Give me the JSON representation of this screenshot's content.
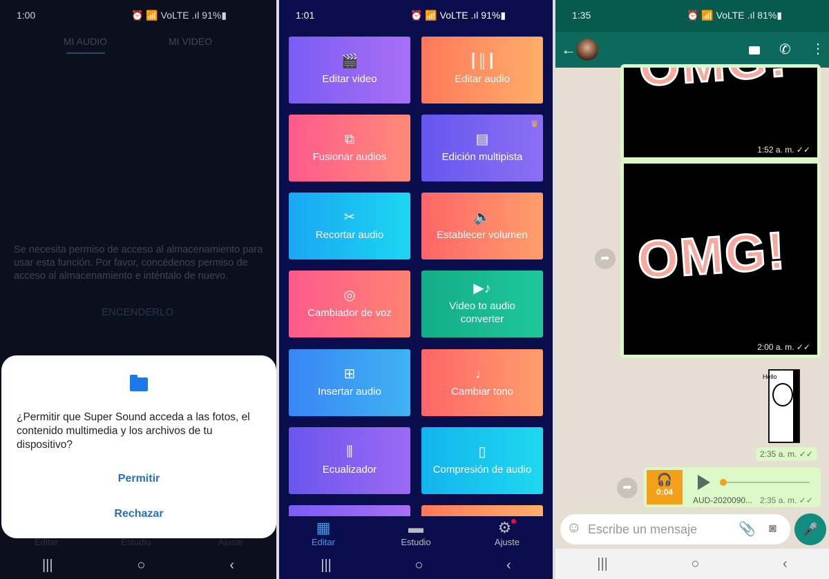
{
  "panel1": {
    "status": {
      "time": "1:00",
      "icons": "⏰ 📶 VoLTE .ıl 91%▮"
    },
    "tabs": [
      "MI AUDIO",
      "MI VIDEO"
    ],
    "message": "Se necesita permiso de acceso al almacenamiento para usar esta función. Por favor, concédenos permiso de acceso al almacenamiento e inténtalo de nuevo.",
    "turn_on": "ENCENDERLO",
    "dialog": {
      "icon": "folder-icon",
      "question": "¿Permitir que Super Sound acceda a las fotos, el contenido multimedia y los archivos de tu dispositivo?",
      "allow": "Permitir",
      "deny": "Rechazar"
    },
    "nav": [
      "Editar",
      "Estudio",
      "Ajuste"
    ]
  },
  "panel2": {
    "status": {
      "time": "1:01",
      "icons": "⏰ 📶 VoLTE .ıl 91%▮"
    },
    "tiles": [
      {
        "label": "Editar video",
        "icon": "🎬",
        "from": "#7a5cf6",
        "to": "#a86ff3"
      },
      {
        "label": "Editar audio",
        "icon": "┃║┃",
        "from": "#ff785a",
        "to": "#ffae68"
      },
      {
        "label": "Fusionar audios",
        "icon": "⧉",
        "from": "#ff5a8c",
        "to": "#ff8a78"
      },
      {
        "label": "Edición multipista",
        "icon": "▤",
        "from": "#6557ee",
        "to": "#8b6ff4",
        "crown": "♛"
      },
      {
        "label": "Recortar audio",
        "icon": "✂",
        "from": "#1aa6f4",
        "to": "#1cd6f2"
      },
      {
        "label": "Establecer volumen",
        "icon": "🔈",
        "from": "#ff6568",
        "to": "#ff9e6a"
      },
      {
        "label": "Cambiador de voz",
        "icon": "◎",
        "from": "#ff5a8c",
        "to": "#ff8272"
      },
      {
        "label": "Video to audio converter",
        "icon": "▶♪",
        "from": "#14ad86",
        "to": "#1fc79b"
      },
      {
        "label": "Insertar audio",
        "icon": "⊞",
        "from": "#3886f4",
        "to": "#3fb2f3"
      },
      {
        "label": "Cambiar tono",
        "icon": "♩",
        "from": "#ff6568",
        "to": "#ff9e6a"
      },
      {
        "label": "Ecualizador",
        "icon": "⫼",
        "from": "#6a56ee",
        "to": "#9c6af4"
      },
      {
        "label": "Compresión de audio",
        "icon": "▯",
        "from": "#12b4ee",
        "to": "#1fd8ef"
      }
    ],
    "nav": [
      {
        "label": "Editar",
        "icon": "grid-icon",
        "color": "#3d9be9"
      },
      {
        "label": "Estudio",
        "icon": "folder-icon"
      },
      {
        "label": "Ajuste",
        "icon": "gear-icon"
      }
    ]
  },
  "panel3": {
    "status": {
      "time": "1:35",
      "icons": "⏰ 📶 VoLTE .ıl 81%▮"
    },
    "images": [
      {
        "text": "OMG!",
        "time": "1:52 a. m. ✓✓"
      },
      {
        "text": "OMG!",
        "time": "2:00 a. m. ✓✓"
      }
    ],
    "sticker": {
      "text": "Hello",
      "time": "2:35 a. m. ✓✓"
    },
    "audio": {
      "duration": "0:04",
      "name": "AUD-2020090...",
      "time": "2:35 a. m. ✓✓",
      "progress": 0
    },
    "input_placeholder": "Escribe un mensaje"
  }
}
